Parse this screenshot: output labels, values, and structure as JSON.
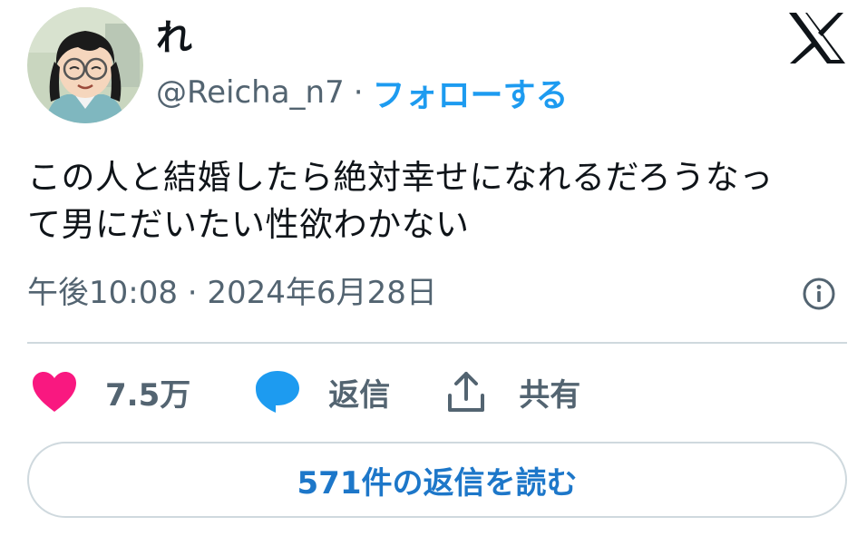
{
  "tweet": {
    "author": {
      "display_name": "れ",
      "handle": "@Reicha_n7",
      "separator": "·",
      "follow_label": "フォローする",
      "avatar_icon": "avatar-illustration"
    },
    "brand_icon": "x-logo-icon",
    "text_lines": [
      "この人と結婚したら絶対幸せになれるだろうなっ",
      "て男にだいたい性欲わかない"
    ],
    "timestamp": "午後10:08 · 2024年6月28日",
    "info_icon": "info-icon",
    "actions": {
      "like_count": "7.5万",
      "reply_label": "返信",
      "share_label": "共有"
    },
    "read_replies_label": "571件の返信を読む"
  },
  "colors": {
    "accent": "#1d9bf0",
    "like": "#f91880",
    "reply_bubble": "#1d9bf0",
    "secondary_text": "#536471",
    "border": "#cfd9de"
  }
}
